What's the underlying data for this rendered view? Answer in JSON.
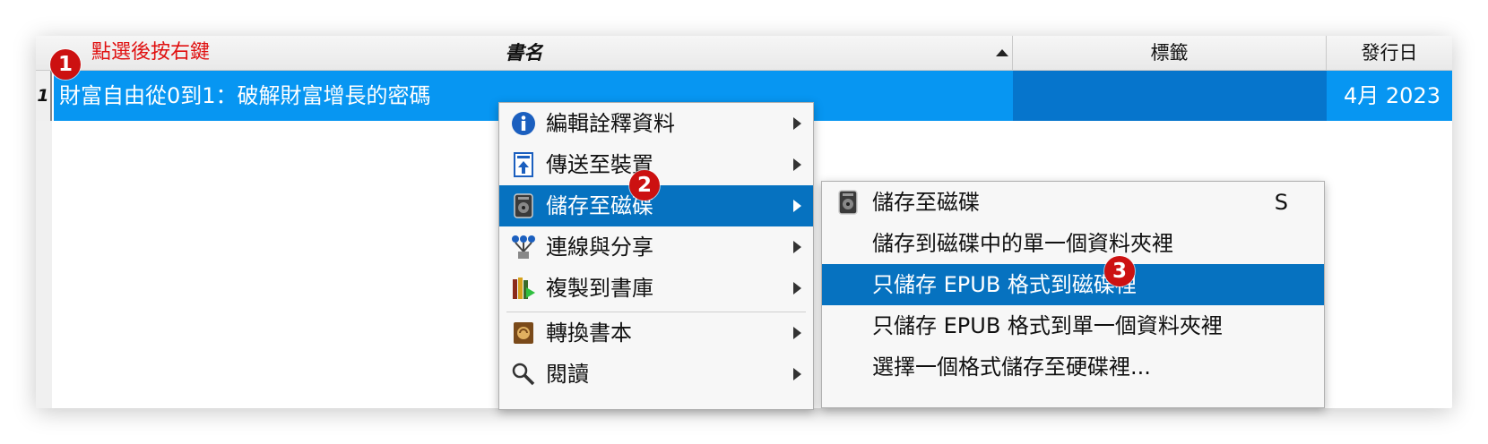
{
  "table": {
    "columns": {
      "title": "書名",
      "tags": "標籤",
      "date": "發行日"
    },
    "row": {
      "number": "1",
      "title": "財富自由從0到1：破解財富增長的密碼",
      "date": "4月 2023"
    }
  },
  "annotations": {
    "hint": "點選後按右鍵",
    "badge1": "1",
    "badge2": "2",
    "badge3": "3",
    "color": "#cc1111"
  },
  "context_menu": {
    "items": [
      {
        "label": "編輯詮釋資料",
        "icon": "info-icon"
      },
      {
        "label": "傳送至裝置",
        "icon": "send-to-device-icon"
      },
      {
        "label": "儲存至磁碟",
        "icon": "disk-save-icon",
        "highlighted": true
      },
      {
        "label": "連線與分享",
        "icon": "network-share-icon"
      },
      {
        "label": "複製到書庫",
        "icon": "copy-to-library-icon"
      },
      {
        "label": "轉換書本",
        "icon": "convert-book-icon"
      },
      {
        "label": "閱讀",
        "icon": "magnifier-icon"
      }
    ]
  },
  "submenu": {
    "items": [
      {
        "label": "儲存至磁碟",
        "shortcut": "S",
        "icon": "disk-save-icon"
      },
      {
        "label": "儲存到磁碟中的單一個資料夾裡"
      },
      {
        "label": "只儲存 EPUB 格式到磁碟裡",
        "highlighted": true
      },
      {
        "label": "只儲存 EPUB 格式到單一個資料夾裡"
      },
      {
        "label": "選擇一個格式儲存至硬碟裡..."
      }
    ]
  },
  "colors": {
    "selection": "#0796f2",
    "menu_highlight": "#0672c0",
    "badge": "#cc1111"
  }
}
